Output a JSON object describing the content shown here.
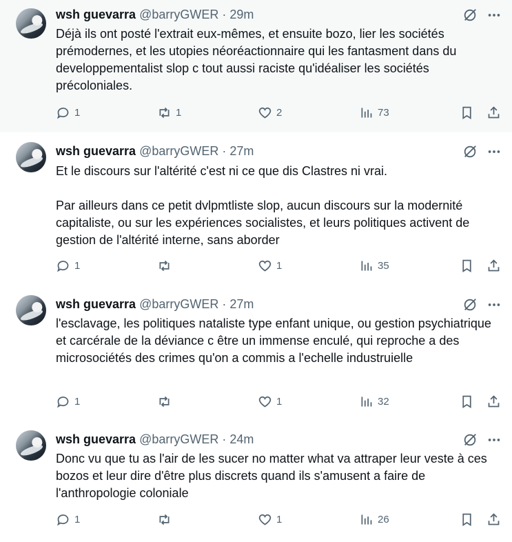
{
  "tweets": [
    {
      "name": "wsh guevarra",
      "handle": "@barryGWER",
      "time": "29m",
      "text": "Déjà ils ont posté l'extrait eux-mêmes, et ensuite bozo, lier les sociétés prémodernes, et les utopies néoréactionnaire qui les fantasment dans du developpementalist slop c tout aussi raciste qu'idéaliser les sociétés précoloniales.",
      "replies": "1",
      "reposts": "1",
      "likes": "2",
      "views": "73"
    },
    {
      "name": "wsh guevarra",
      "handle": "@barryGWER",
      "time": "27m",
      "text": "Et le discours sur l'altérité c'est ni ce que dis Clastres ni vrai.\n\nPar ailleurs dans ce petit dvlpmtliste slop, aucun discours sur la modernité capitaliste, ou sur les expériences socialistes, et leurs politiques activent de gestion de l'altérité interne, sans aborder",
      "replies": "1",
      "reposts": "",
      "likes": "1",
      "views": "35"
    },
    {
      "name": "wsh guevarra",
      "handle": "@barryGWER",
      "time": "27m",
      "text": "l'esclavage, les politiques nataliste type enfant unique, ou gestion psychiatrique et carcérale de la déviance c être un immense enculé, qui reproche a des microsociétés des crimes qu'on a commis a l'echelle industruielle",
      "replies": "1",
      "reposts": "",
      "likes": "1",
      "views": "32"
    },
    {
      "name": "wsh guevarra",
      "handle": "@barryGWER",
      "time": "24m",
      "text": "Donc vu que tu as l'air de les sucer no matter what va attraper leur veste à ces bozos et leur dire d'être plus discrets quand ils s'amusent a faire de l'anthropologie coloniale",
      "replies": "1",
      "reposts": "",
      "likes": "1",
      "views": "26"
    }
  ],
  "separator": " · ",
  "icons": {
    "grok": "grok-slash-icon",
    "more": "more-dots-icon",
    "reply": "reply-bubble-icon",
    "repost": "repost-arrows-icon",
    "like": "heart-icon",
    "views": "views-bars-icon",
    "bookmark": "bookmark-icon",
    "share": "share-icon"
  },
  "colors": {
    "text": "#0f1419",
    "secondary": "#536471",
    "highlight_bg": "#f7f9f9"
  }
}
